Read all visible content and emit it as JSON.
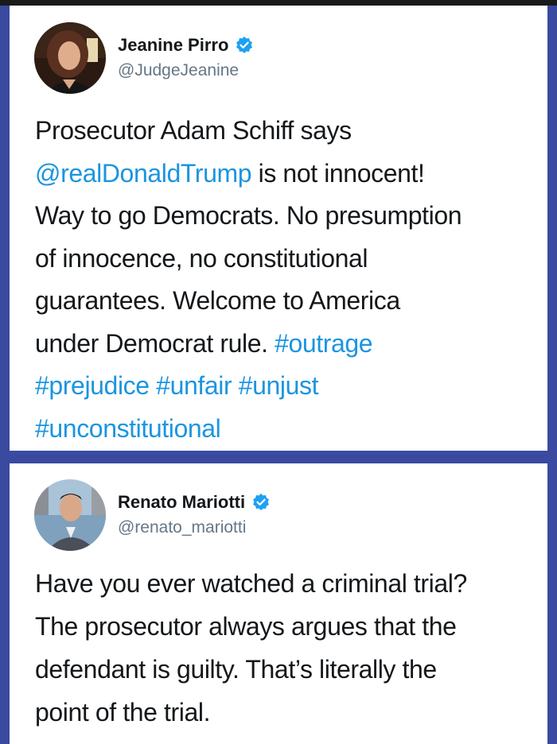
{
  "tweets": [
    {
      "author": {
        "name": "Jeanine Pirro",
        "handle": "@JudgeJeanine",
        "verified": true
      },
      "lines": [
        [
          {
            "t": "Prosecutor Adam Schiff says",
            "link": false
          }
        ],
        [
          {
            "t": "@realDonaldTrump",
            "link": true
          },
          {
            "t": " is not innocent!",
            "link": false
          }
        ],
        [
          {
            "t": "Way to go Democrats. No presumption",
            "link": false
          }
        ],
        [
          {
            "t": "of innocence, no constitutional",
            "link": false
          }
        ],
        [
          {
            "t": "guarantees. Welcome to America",
            "link": false
          }
        ],
        [
          {
            "t": "under Democrat rule. ",
            "link": false
          },
          {
            "t": "#outrage",
            "link": true
          }
        ],
        [
          {
            "t": "#prejudice",
            "link": true
          },
          {
            "t": " ",
            "link": false
          },
          {
            "t": "#unfair",
            "link": true
          },
          {
            "t": " ",
            "link": false
          },
          {
            "t": "#unjust",
            "link": true
          }
        ],
        [
          {
            "t": "#unconstitutional",
            "link": true
          }
        ]
      ]
    },
    {
      "author": {
        "name": "Renato Mariotti",
        "handle": "@renato_mariotti",
        "verified": true
      },
      "lines": [
        [
          {
            "t": "Have you ever watched a criminal trial?",
            "link": false
          }
        ],
        [
          {
            "t": "The prosecutor always argues that the",
            "link": false
          }
        ],
        [
          {
            "t": "defendant is guilty. That’s literally the",
            "link": false
          }
        ],
        [
          {
            "t": "point of the trial.",
            "link": false
          }
        ]
      ]
    }
  ],
  "colors": {
    "background": "#3a4aa0",
    "link": "#1b95e0",
    "verified": "#1da1f2",
    "text": "#14171a",
    "handle": "#657786"
  },
  "icons": [
    "verified-badge-icon"
  ]
}
